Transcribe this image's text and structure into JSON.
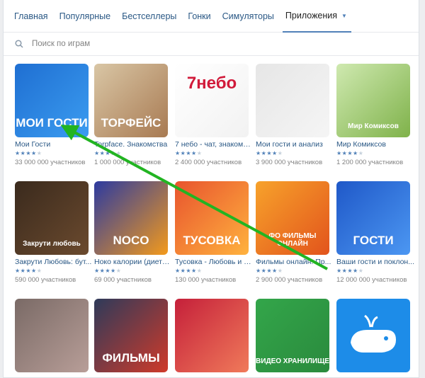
{
  "tabs": [
    {
      "label": "Главная"
    },
    {
      "label": "Популярные"
    },
    {
      "label": "Бестселлеры"
    },
    {
      "label": "Гонки"
    },
    {
      "label": "Симуляторы"
    },
    {
      "label": "Приложения",
      "active": true
    }
  ],
  "search": {
    "placeholder": "Поиск по играм"
  },
  "apps": [
    {
      "name": "Мои Гости",
      "rating": 4,
      "users": "33 000 000 участников",
      "thumb_text": "МОИ ГОСТИ",
      "colors": [
        "#1f6fd2",
        "#3b9cf0"
      ]
    },
    {
      "name": "Torpface. Знакомства",
      "rating": 4,
      "users": "1 000 000 участников",
      "thumb_text": "ТОРФЕЙС",
      "colors": [
        "#d9c6a5",
        "#a87a52"
      ]
    },
    {
      "name": "7 небо - чат, знакомс...",
      "rating": 4,
      "users": "2 400 000 участников",
      "thumb_text": "7небо",
      "colors": [
        "#ffffff",
        "#f2f2f2"
      ]
    },
    {
      "name": "Мои гости и анализ",
      "rating": 4,
      "users": "3 900 000 участников",
      "thumb_text": "",
      "colors": [
        "#e6e6e6",
        "#f5f5f5"
      ]
    },
    {
      "name": "Мир Комиксов",
      "rating": 4,
      "users": "1 200 000 участников",
      "thumb_text": "Мир Комиксов",
      "colors": [
        "#cfe9b0",
        "#7fb24a"
      ]
    },
    {
      "name": "Закрути Любовь: бут...",
      "rating": 4,
      "users": "590 000 участников",
      "thumb_text": "Закрути любовь",
      "colors": [
        "#3a2a1d",
        "#6b4a2e"
      ]
    },
    {
      "name": "Ноко калории (диета...",
      "rating": 4,
      "users": "69 000 участников",
      "thumb_text": "NOCO",
      "colors": [
        "#2c3aa0",
        "#f39a1c"
      ]
    },
    {
      "name": "Тусовка - Любовь и з...",
      "rating": 4,
      "users": "130 000 участников",
      "thumb_text": "ТУСОВКА",
      "colors": [
        "#e8542e",
        "#ffb23e"
      ]
    },
    {
      "name": "Фильмы онлайн. Пр...",
      "rating": 4,
      "users": "2 900 000 участников",
      "thumb_text": "ФО ФИЛЬМЫ ОНЛАЙН",
      "colors": [
        "#f7a22b",
        "#e2541c"
      ]
    },
    {
      "name": "Ваши гости и поклон...",
      "rating": 4,
      "users": "12 000 000 участников",
      "thumb_text": "ГОСТИ",
      "colors": [
        "#1f58c8",
        "#4c97f2"
      ]
    },
    {
      "name": "",
      "rating": 0,
      "users": "",
      "thumb_text": "",
      "colors": [
        "#7a6a66",
        "#b89e98"
      ]
    },
    {
      "name": "",
      "rating": 0,
      "users": "",
      "thumb_text": "ФИЛЬМЫ",
      "colors": [
        "#2e3a5a",
        "#cf3a2a"
      ]
    },
    {
      "name": "",
      "rating": 0,
      "users": "",
      "thumb_text": "",
      "colors": [
        "#c5203a",
        "#f07a5a"
      ]
    },
    {
      "name": "",
      "rating": 0,
      "users": "",
      "thumb_text": "ВИДЕО ХРАНИЛИЩЕ",
      "colors": [
        "#33a64a",
        "#2a8a3d"
      ]
    },
    {
      "name": "",
      "rating": 0,
      "users": "",
      "thumb_text": "",
      "colors": [
        "#1d8ce8",
        "#1d8ce8"
      ]
    }
  ],
  "annotation": {
    "color": "#22b422"
  }
}
